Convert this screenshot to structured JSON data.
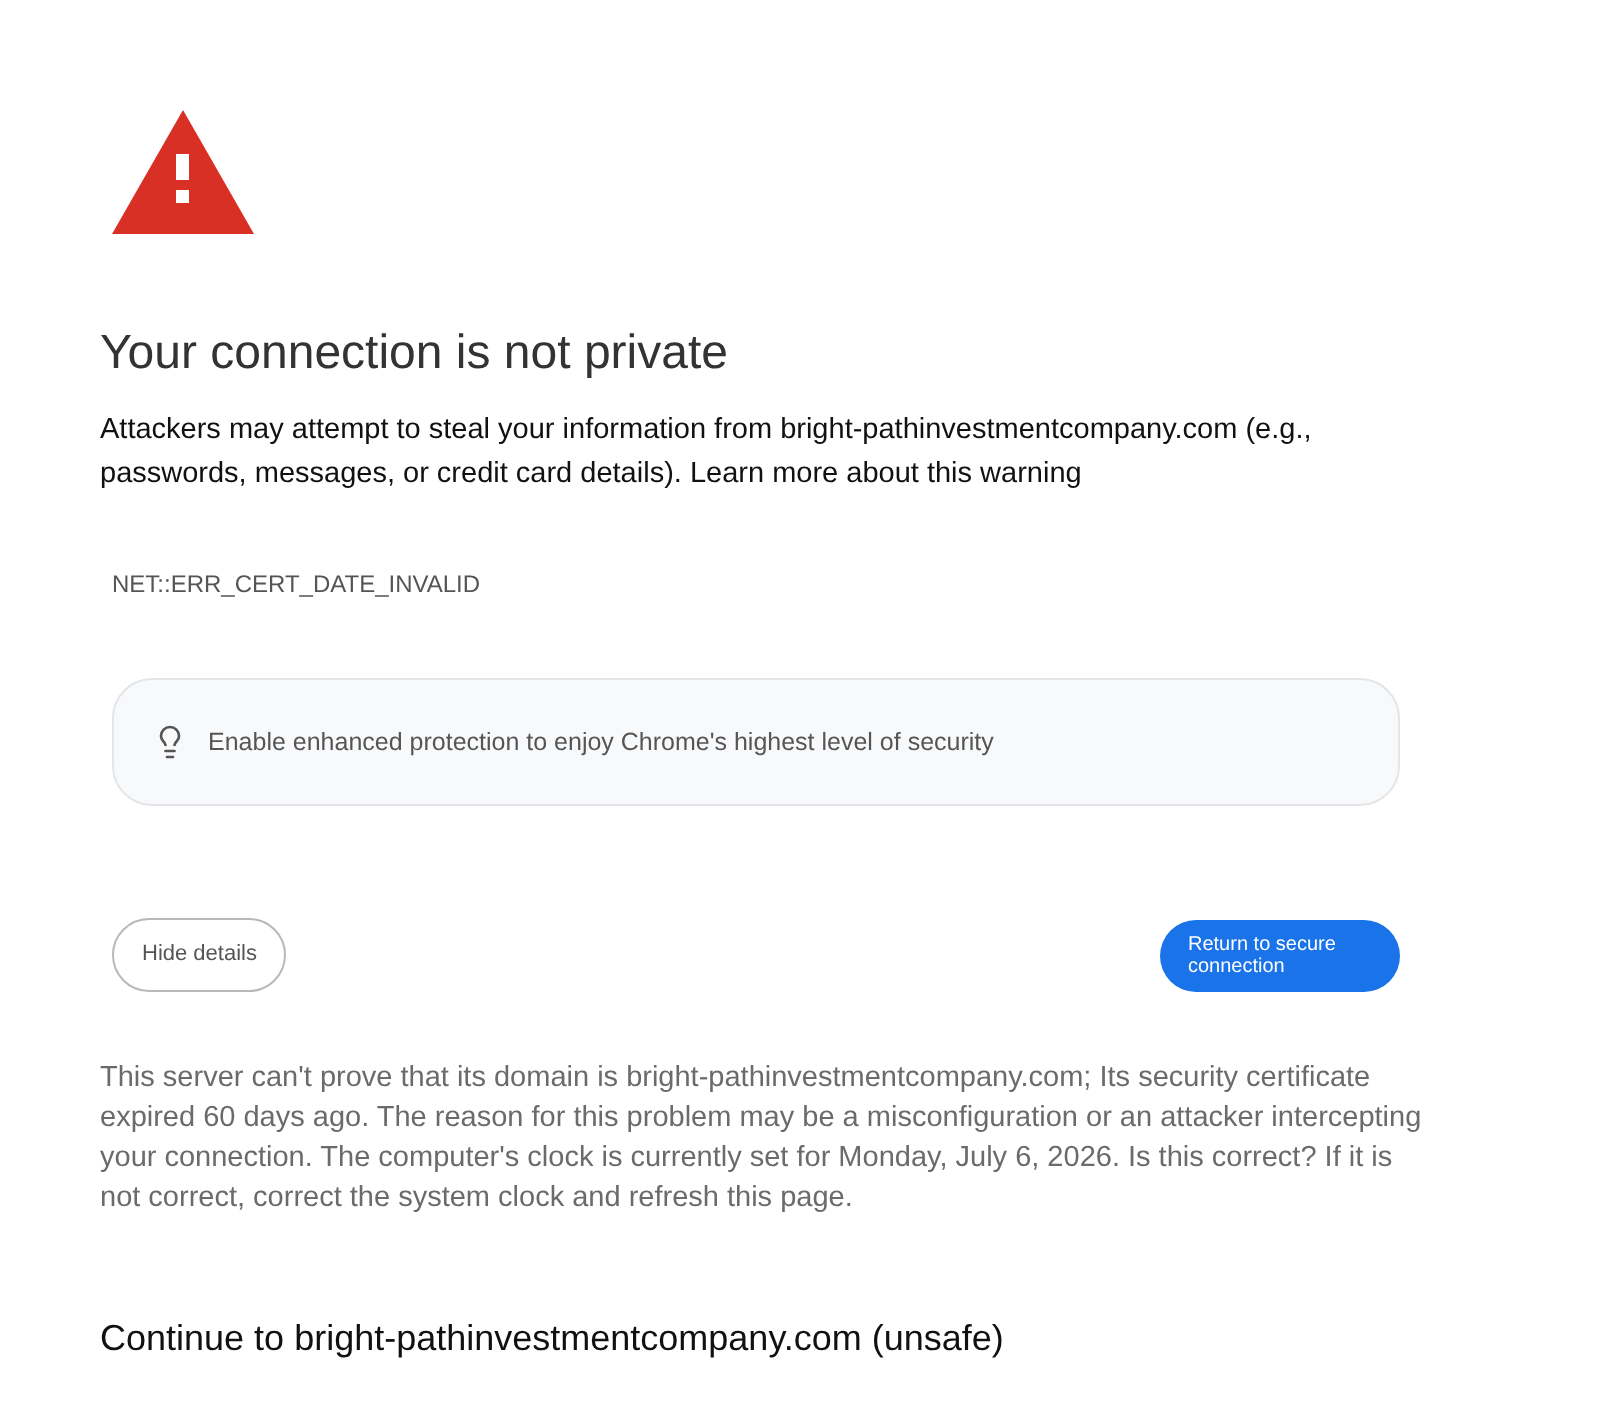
{
  "heading": "Your connection is not private",
  "message": {
    "text": "Attackers may attempt to steal your information from bright-pathinvestmentcompany.com (e.g., passwords, messages, or credit card details).",
    "link": "Learn more about this warning"
  },
  "error_code": "NET::ERR_CERT_DATE_INVALID",
  "tip": {
    "text": "Enable enhanced protection to enjoy Chrome's highest level of security"
  },
  "buttons": [
    {
      "label": "Hide details",
      "kind": "secondary"
    },
    {
      "label": "Return to secure connection",
      "kind": "primary"
    }
  ],
  "details": "This server can't prove that its domain is bright-pathinvestmentcompany.com; Its security certificate expired 60 days ago. The reason for this problem may be a misconfiguration or an attacker intercepting your connection. The computer's clock is currently set for Monday, July 6, 2026. Is this correct? If it is not correct, correct the system clock and refresh this page.",
  "proceed_link": "Continue to bright-pathinvestmentcompany.com (unsafe)"
}
